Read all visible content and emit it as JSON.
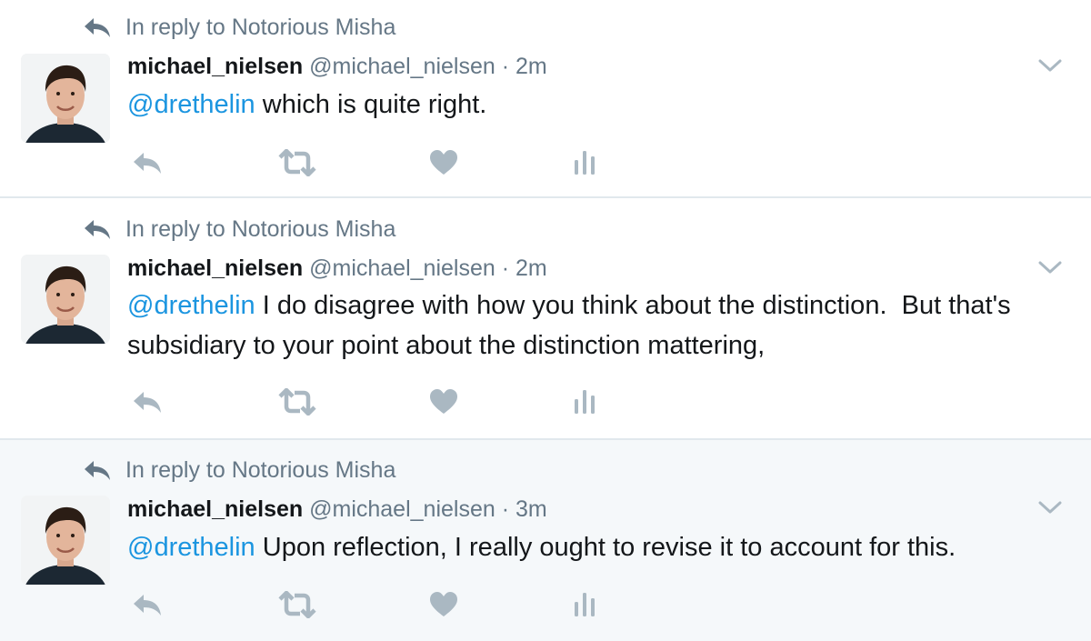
{
  "colors": {
    "mention": "#1b95e0",
    "secondary_text": "#657786",
    "primary_text": "#14171a",
    "icon": "#aab8c2",
    "highlight_background": "#f5f8fa"
  },
  "icons": {
    "context": "reply-arrow-icon",
    "caret": "chevron-down-icon",
    "reply": "reply-icon",
    "retweet": "retweet-icon",
    "like": "heart-icon",
    "analytics": "analytics-icon"
  },
  "tweets": [
    {
      "context": "In reply to Notorious Misha",
      "name": "michael_nielsen",
      "handle": "@michael_nielsen",
      "separator": "·",
      "time": "2m",
      "mention": "@drethelin",
      "text_after_mention": " which is quite right."
    },
    {
      "context": "In reply to Notorious Misha",
      "name": "michael_nielsen",
      "handle": "@michael_nielsen",
      "separator": "·",
      "time": "2m",
      "mention": "@drethelin",
      "text_after_mention": " I do disagree with how you think about the distinction.  But that's subsidiary to your point about the distinction mattering,"
    },
    {
      "context": "In reply to Notorious Misha",
      "name": "michael_nielsen",
      "handle": "@michael_nielsen",
      "separator": "·",
      "time": "3m",
      "mention": "@drethelin",
      "text_after_mention": " Upon reflection, I really ought to revise it to account for this."
    }
  ]
}
